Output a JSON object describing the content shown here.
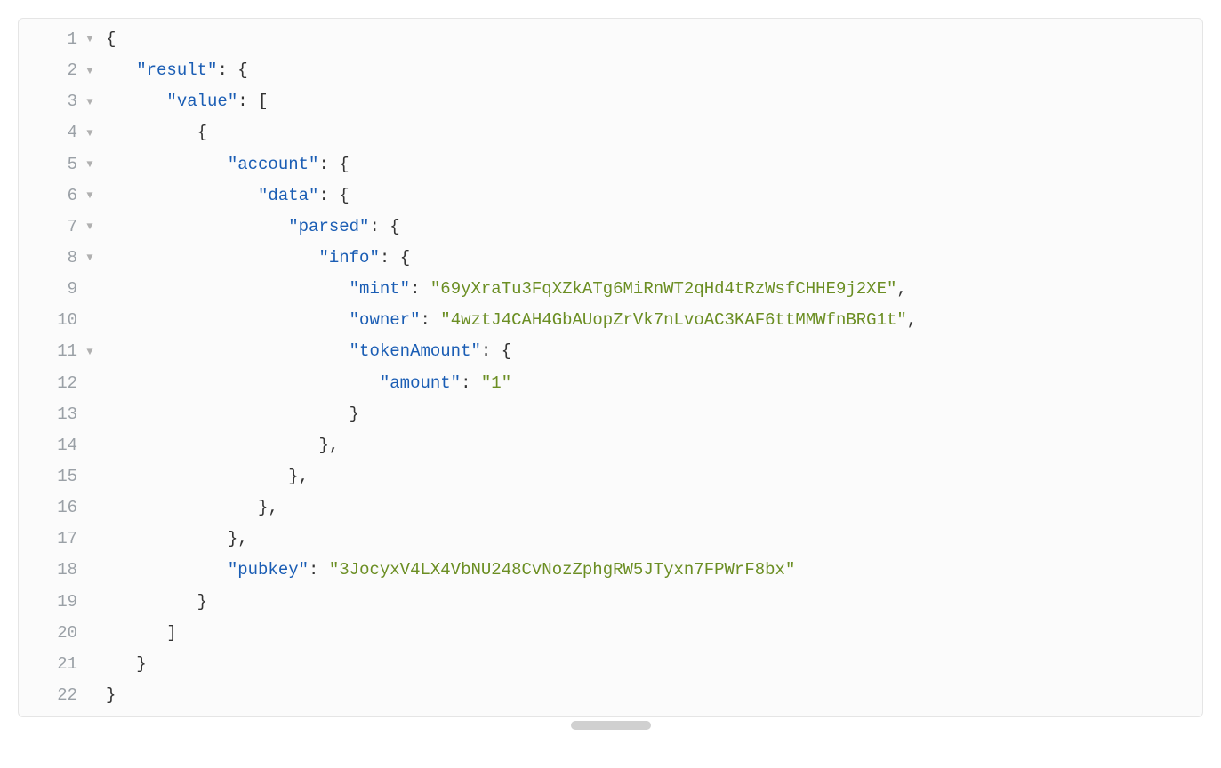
{
  "colors": {
    "key": "#1a5db4",
    "string": "#6b8e23",
    "punctuation": "#333333",
    "gutter": "#9aa0a6",
    "background": "#fbfbfb",
    "border": "#e5e5e5"
  },
  "lines": [
    {
      "num": "1",
      "foldable": true,
      "indent": 0,
      "tokens": [
        {
          "t": "brace",
          "v": "{"
        }
      ]
    },
    {
      "num": "2",
      "foldable": true,
      "indent": 1,
      "tokens": [
        {
          "t": "key",
          "v": "\"result\""
        },
        {
          "t": "colon",
          "v": ": "
        },
        {
          "t": "brace",
          "v": "{"
        }
      ]
    },
    {
      "num": "3",
      "foldable": true,
      "indent": 2,
      "tokens": [
        {
          "t": "key",
          "v": "\"value\""
        },
        {
          "t": "colon",
          "v": ": "
        },
        {
          "t": "bracket",
          "v": "["
        }
      ]
    },
    {
      "num": "4",
      "foldable": true,
      "indent": 3,
      "tokens": [
        {
          "t": "brace",
          "v": "{"
        }
      ]
    },
    {
      "num": "5",
      "foldable": true,
      "indent": 4,
      "tokens": [
        {
          "t": "key",
          "v": "\"account\""
        },
        {
          "t": "colon",
          "v": ": "
        },
        {
          "t": "brace",
          "v": "{"
        }
      ]
    },
    {
      "num": "6",
      "foldable": true,
      "indent": 5,
      "tokens": [
        {
          "t": "key",
          "v": "\"data\""
        },
        {
          "t": "colon",
          "v": ": "
        },
        {
          "t": "brace",
          "v": "{"
        }
      ]
    },
    {
      "num": "7",
      "foldable": true,
      "indent": 6,
      "tokens": [
        {
          "t": "key",
          "v": "\"parsed\""
        },
        {
          "t": "colon",
          "v": ": "
        },
        {
          "t": "brace",
          "v": "{"
        }
      ]
    },
    {
      "num": "8",
      "foldable": true,
      "indent": 7,
      "tokens": [
        {
          "t": "key",
          "v": "\"info\""
        },
        {
          "t": "colon",
          "v": ": "
        },
        {
          "t": "brace",
          "v": "{"
        }
      ]
    },
    {
      "num": "9",
      "foldable": false,
      "indent": 8,
      "tokens": [
        {
          "t": "key",
          "v": "\"mint\""
        },
        {
          "t": "colon",
          "v": ": "
        },
        {
          "t": "string",
          "v": "\"69yXraTu3FqXZkATg6MiRnWT2qHd4tRzWsfCHHE9j2XE\""
        },
        {
          "t": "comma",
          "v": ","
        }
      ]
    },
    {
      "num": "10",
      "foldable": false,
      "indent": 8,
      "tokens": [
        {
          "t": "key",
          "v": "\"owner\""
        },
        {
          "t": "colon",
          "v": ": "
        },
        {
          "t": "string",
          "v": "\"4wztJ4CAH4GbAUopZrVk7nLvoAC3KAF6ttMMWfnBRG1t\""
        },
        {
          "t": "comma",
          "v": ","
        }
      ]
    },
    {
      "num": "11",
      "foldable": true,
      "indent": 8,
      "tokens": [
        {
          "t": "key",
          "v": "\"tokenAmount\""
        },
        {
          "t": "colon",
          "v": ": "
        },
        {
          "t": "brace",
          "v": "{"
        }
      ]
    },
    {
      "num": "12",
      "foldable": false,
      "indent": 9,
      "tokens": [
        {
          "t": "key",
          "v": "\"amount\""
        },
        {
          "t": "colon",
          "v": ": "
        },
        {
          "t": "string",
          "v": "\"1\""
        }
      ]
    },
    {
      "num": "13",
      "foldable": false,
      "indent": 8,
      "tokens": [
        {
          "t": "brace",
          "v": "}"
        }
      ]
    },
    {
      "num": "14",
      "foldable": false,
      "indent": 7,
      "tokens": [
        {
          "t": "brace",
          "v": "}"
        },
        {
          "t": "comma",
          "v": ","
        }
      ]
    },
    {
      "num": "15",
      "foldable": false,
      "indent": 6,
      "tokens": [
        {
          "t": "brace",
          "v": "}"
        },
        {
          "t": "comma",
          "v": ","
        }
      ]
    },
    {
      "num": "16",
      "foldable": false,
      "indent": 5,
      "tokens": [
        {
          "t": "brace",
          "v": "}"
        },
        {
          "t": "comma",
          "v": ","
        }
      ]
    },
    {
      "num": "17",
      "foldable": false,
      "indent": 4,
      "tokens": [
        {
          "t": "brace",
          "v": "}"
        },
        {
          "t": "comma",
          "v": ","
        }
      ]
    },
    {
      "num": "18",
      "foldable": false,
      "indent": 4,
      "tokens": [
        {
          "t": "key",
          "v": "\"pubkey\""
        },
        {
          "t": "colon",
          "v": ": "
        },
        {
          "t": "string",
          "v": "\"3JocyxV4LX4VbNU248CvNozZphgRW5JTyxn7FPWrF8bx\""
        }
      ]
    },
    {
      "num": "19",
      "foldable": false,
      "indent": 3,
      "tokens": [
        {
          "t": "brace",
          "v": "}"
        }
      ]
    },
    {
      "num": "20",
      "foldable": false,
      "indent": 2,
      "tokens": [
        {
          "t": "bracket",
          "v": "]"
        }
      ]
    },
    {
      "num": "21",
      "foldable": false,
      "indent": 1,
      "tokens": [
        {
          "t": "brace",
          "v": "}"
        }
      ]
    },
    {
      "num": "22",
      "foldable": false,
      "indent": 0,
      "tokens": [
        {
          "t": "brace",
          "v": "}"
        }
      ]
    }
  ],
  "fold_glyph": "▼",
  "indent_string": "   "
}
